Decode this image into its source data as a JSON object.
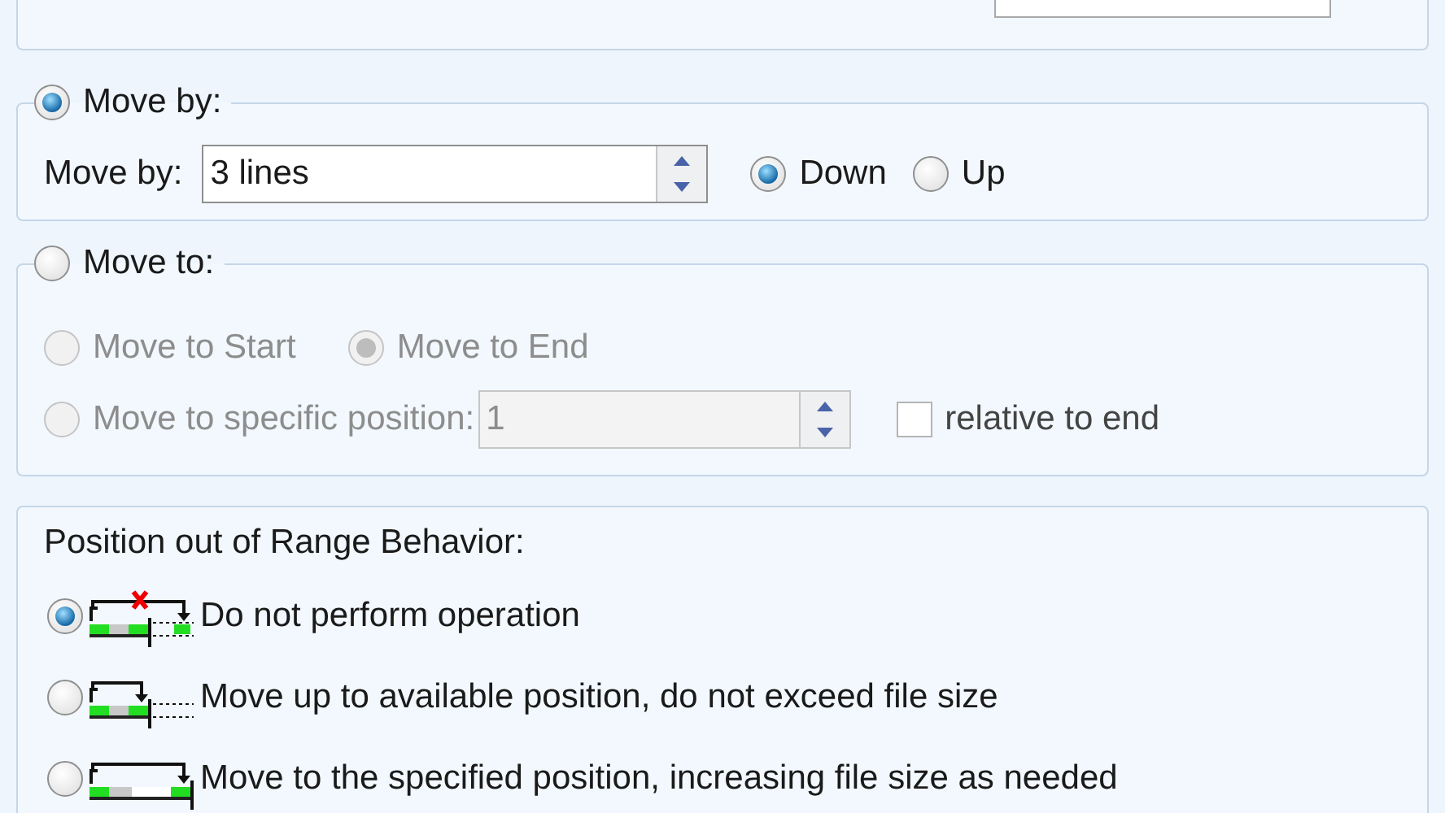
{
  "move_by_group": {
    "label": "Move by:",
    "selected": true,
    "field_label": "Move by:",
    "value": "3 lines",
    "directions": [
      {
        "label": "Down",
        "selected": true
      },
      {
        "label": "Up",
        "selected": false
      }
    ]
  },
  "move_to_group": {
    "label": "Move to:",
    "selected": false,
    "options": [
      {
        "label": "Move to Start",
        "selected": false,
        "disabled": true
      },
      {
        "label": "Move to End",
        "selected": true,
        "disabled": true
      }
    ],
    "specific": {
      "label": "Move to specific position:",
      "selected": false,
      "disabled": true,
      "value": "1"
    },
    "relative": {
      "label": "relative to end",
      "checked": false
    }
  },
  "range_behavior": {
    "title": "Position out of Range Behavior:",
    "options": [
      {
        "label": "Do not perform operation",
        "selected": true,
        "kind": "blocked"
      },
      {
        "label": "Move up to available position, do not exceed file size",
        "selected": false,
        "kind": "clamp"
      },
      {
        "label": "Move to the specified position, increasing file size as needed",
        "selected": false,
        "kind": "extend"
      }
    ]
  }
}
